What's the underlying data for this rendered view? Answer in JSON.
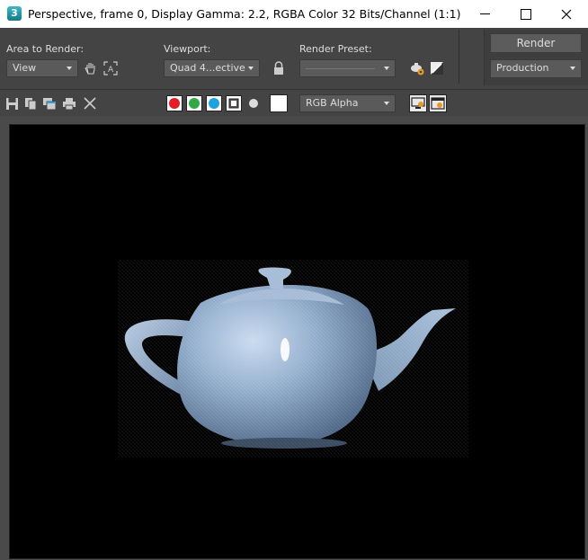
{
  "window": {
    "app_icon_text": "3",
    "title": "Perspective, frame 0, Display Gamma: 2.2, RGBA Color 32 Bits/Channel (1:1)"
  },
  "setup": {
    "area_label": "Area to Render:",
    "area_value": "View",
    "viewport_label": "Viewport:",
    "viewport_value": "Quad 4...ective",
    "preset_label": "Render Preset:",
    "preset_value": "",
    "render_button": "Render",
    "render_mode": "Production"
  },
  "toolbar": {
    "channel_display": "RGB Alpha",
    "channels": [
      {
        "name": "red",
        "color": "#e51c23"
      },
      {
        "name": "green",
        "color": "#35a845"
      },
      {
        "name": "blue",
        "color": "#1ea1e0"
      }
    ]
  },
  "colors": {
    "teapot": "#8da8c6",
    "background": "#000000",
    "panel": "#444444"
  }
}
